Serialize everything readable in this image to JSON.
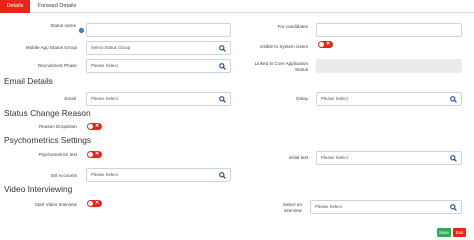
{
  "tabs": [
    {
      "label": "Details",
      "active": true
    },
    {
      "label": "Forward Details",
      "active": false
    }
  ],
  "help_icon_glyph": "?",
  "toggle_off_glyph": "✕",
  "top": {
    "status_name_label": "Status name",
    "status_name_value": "",
    "for_candidates_label": "For candidates",
    "for_candidates_value": "",
    "mobile_app_label": "Mobile App Status Group",
    "mobile_app_placeholder": "Select Status Group",
    "visible_label": "Visible to System Users",
    "visible_on": false,
    "recruitment_phase_label": "Recruitment Phase",
    "recruitment_phase_placeholder": "Please Select",
    "linked_label_line1": "Linked to Core Application",
    "linked_label_line2": "Status",
    "linked_value": ""
  },
  "email": {
    "heading": "Email Details",
    "email_label": "Email",
    "email_placeholder": "Please Select",
    "delay_label": "Delay",
    "delay_placeholder": "Please Select"
  },
  "status_change": {
    "heading": "Status Change Reason",
    "reason_label": "Reason Dropdown",
    "reason_on": false
  },
  "psychometrics": {
    "heading": "Psychometrics Settings",
    "test_label": "Psychometrics test",
    "test_on": false,
    "initial_test_label": "Initial test",
    "initial_test_placeholder": "Please Select",
    "shl_label": "Shl Accounts",
    "shl_placeholder": "Please Select"
  },
  "video": {
    "heading": "Video Interviewing",
    "start_label": "Start Video Interview",
    "start_on": false,
    "select_label_line1": "Select an",
    "select_label_line2": "interview",
    "select_placeholder": "Please Select"
  },
  "actions": {
    "save_label": "Save",
    "exit_label": "Exit"
  },
  "colors": {
    "accent_red": "#e8251a",
    "save_green": "#3aa853",
    "icon_blue": "#1f4e8c",
    "help_blue": "#1f6fb5"
  },
  "icons": {
    "search": "search-icon",
    "help": "help-icon"
  }
}
